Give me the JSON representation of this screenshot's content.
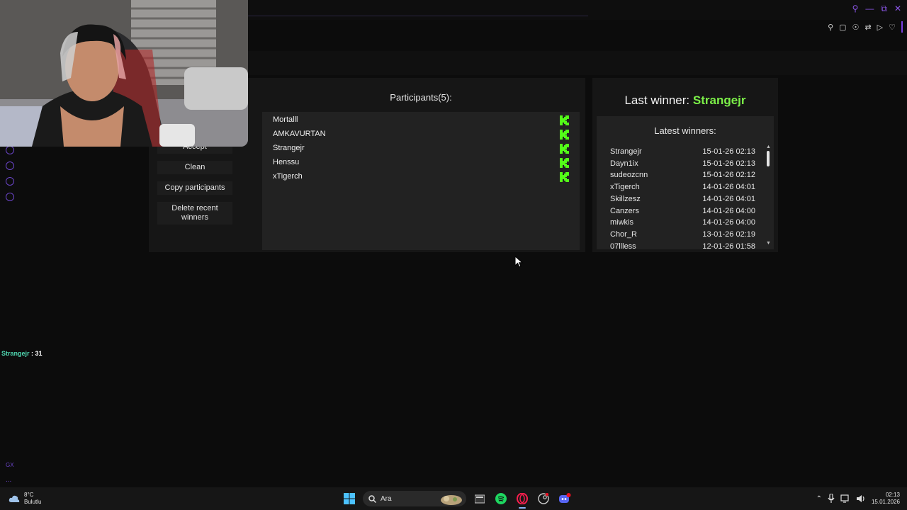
{
  "side_buttons": {
    "accept": "Accept",
    "clean": "Clean",
    "copy_participants": "Copy participants",
    "delete_recent_winners": "Delete recent winners"
  },
  "participants": {
    "title": "Participants(5):",
    "items": [
      {
        "name": "Mortalll"
      },
      {
        "name": "AMKAVURTAN"
      },
      {
        "name": "Strangejr"
      },
      {
        "name": "Henssu"
      },
      {
        "name": "xTigerch"
      }
    ],
    "platform_icon": "kick-icon",
    "platform_color": "#53fc18"
  },
  "last_winner": {
    "label": "Last winner:",
    "name": "Strangejr",
    "color": "#7cf048"
  },
  "latest_winners": {
    "title": "Latest winners:",
    "items": [
      {
        "name": "Strangejr",
        "date": "15-01-26 02:13"
      },
      {
        "name": "Dayn1ix",
        "date": "15-01-26 02:13"
      },
      {
        "name": "sudeozcnn",
        "date": "15-01-26 02:12"
      },
      {
        "name": "xTigerch",
        "date": "14-01-26 04:01"
      },
      {
        "name": "Skillzesz",
        "date": "14-01-26 04:01"
      },
      {
        "name": "Canzers",
        "date": "14-01-26 04:00"
      },
      {
        "name": "miwkis",
        "date": "14-01-26 04:00"
      },
      {
        "name": "Chor_R",
        "date": "13-01-26 02:19"
      },
      {
        "name": "07llless",
        "date": "12-01-26 01:58"
      }
    ]
  },
  "chat": {
    "user": "Strangejr",
    "message": ": 31"
  },
  "sidebar": {
    "gx_label": "GX",
    "more_label": "..."
  },
  "taskbar": {
    "weather_temp": "8°C",
    "weather_desc": "Bulutlu",
    "search_placeholder": "Ara",
    "time": "02:13",
    "date": "15.01.2026",
    "apps": [
      "windows-start-icon",
      "search-icon",
      "widgets-icon",
      "file-explorer-icon",
      "spotify-icon",
      "opera-gx-icon",
      "steam-icon",
      "discord-icon"
    ]
  }
}
